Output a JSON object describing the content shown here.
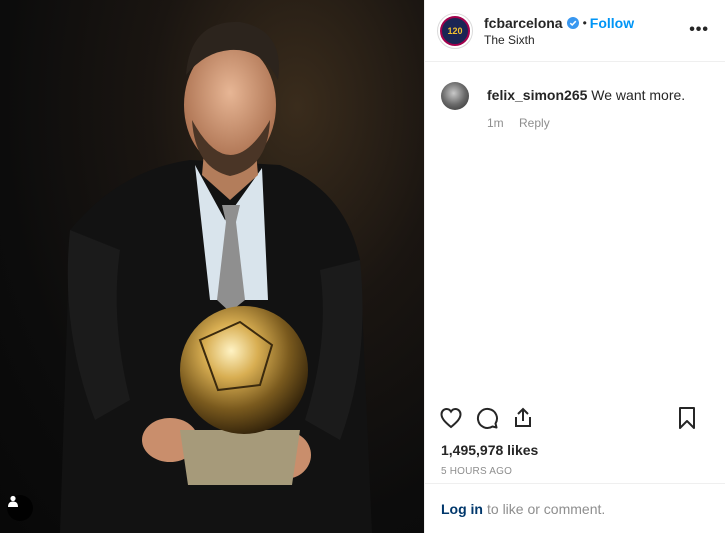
{
  "post": {
    "username": "fcbarcelona",
    "follow_label": "Follow",
    "dot": "•",
    "location": "The Sixth",
    "avatar_text": "120",
    "more_label": "•••",
    "likes": "1,495,978 likes",
    "time": "5 HOURS AGO"
  },
  "comments": [
    {
      "username": "felix_simon265",
      "text": "We want more.",
      "age": "1m",
      "reply_label": "Reply"
    }
  ],
  "login": {
    "link_label": "Log in",
    "suffix": "to like or comment."
  },
  "colors": {
    "accent": "#0095f6",
    "link_dark": "#00376b",
    "muted": "#8e8e8e",
    "text": "#262626",
    "border": "#efefef"
  },
  "icons": [
    "verified-badge-icon",
    "more-options-icon",
    "heart-icon",
    "comment-icon",
    "share-icon",
    "bookmark-icon",
    "user-tag-icon"
  ]
}
